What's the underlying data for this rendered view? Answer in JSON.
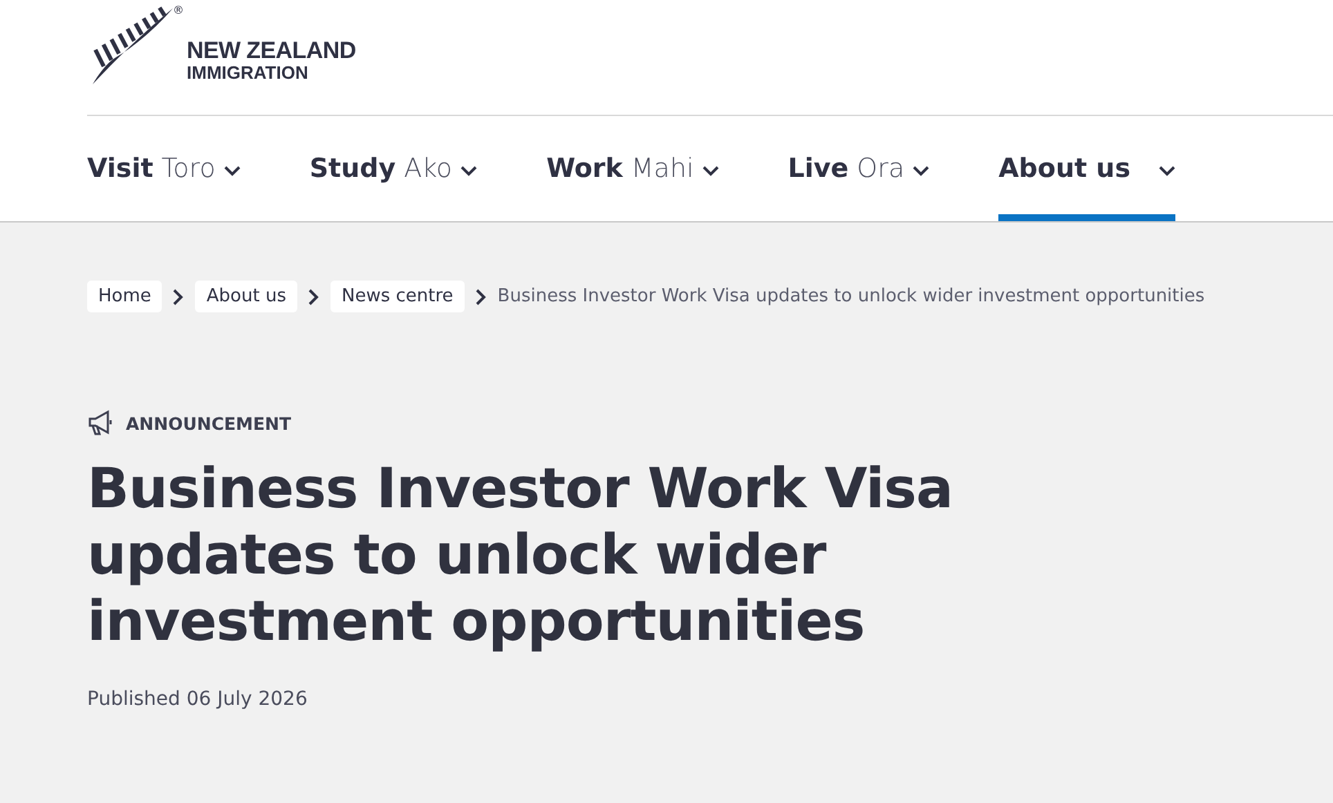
{
  "logo": {
    "line_1": "NEW ZEALAND",
    "line_2": "IMMIGRATION",
    "mark": "®"
  },
  "nav": [
    {
      "label": "Visit",
      "maori": "Toro",
      "selected": false
    },
    {
      "label": "Study",
      "maori": "Ako",
      "selected": false
    },
    {
      "label": "Work",
      "maori": "Mahi",
      "selected": false
    },
    {
      "label": "Live",
      "maori": "Ora",
      "selected": false
    },
    {
      "label": "About us",
      "selected": true
    }
  ],
  "breadcrumbs": {
    "links": [
      "Home",
      "About us",
      "News centre"
    ],
    "current": "Business Investor Work Visa updates to unlock wider investment opportunities"
  },
  "article": {
    "category": "ANNOUNCEMENT",
    "title": "Business Investor Work Visa updates to unlock wider investment opportunities",
    "published": "Published 06 July 2026"
  }
}
